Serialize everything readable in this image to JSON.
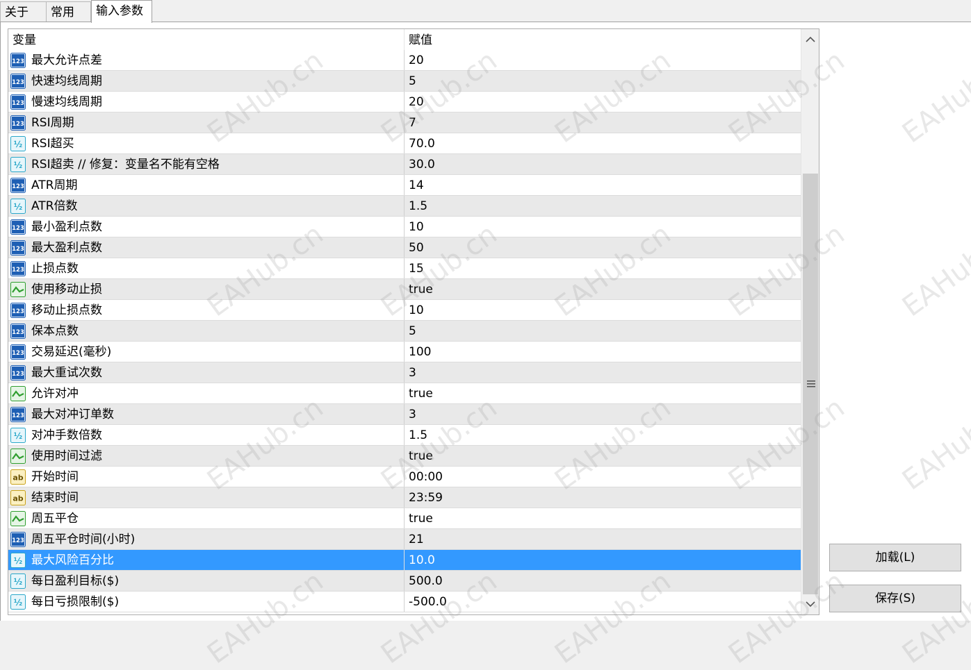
{
  "tabs": [
    {
      "label": "关于",
      "active": false
    },
    {
      "label": "常用",
      "active": false
    },
    {
      "label": "输入参数",
      "active": true
    }
  ],
  "table": {
    "columns": [
      "变量",
      "赋值"
    ],
    "rows": [
      {
        "type": "int",
        "name": "最大允许点差",
        "value": "20"
      },
      {
        "type": "int",
        "name": "快速均线周期",
        "value": "5"
      },
      {
        "type": "int",
        "name": "慢速均线周期",
        "value": "20"
      },
      {
        "type": "int",
        "name": "RSI周期",
        "value": "7"
      },
      {
        "type": "double",
        "name": "RSI超买",
        "value": "70.0"
      },
      {
        "type": "double",
        "name": "RSI超卖  // 修复：变量名不能有空格",
        "value": "30.0"
      },
      {
        "type": "int",
        "name": "ATR周期",
        "value": "14"
      },
      {
        "type": "double",
        "name": "ATR倍数",
        "value": "1.5"
      },
      {
        "type": "int",
        "name": "最小盈利点数",
        "value": "10"
      },
      {
        "type": "int",
        "name": "最大盈利点数",
        "value": "50"
      },
      {
        "type": "int",
        "name": "止损点数",
        "value": "15"
      },
      {
        "type": "bool",
        "name": "使用移动止损",
        "value": "true"
      },
      {
        "type": "int",
        "name": "移动止损点数",
        "value": "10"
      },
      {
        "type": "int",
        "name": "保本点数",
        "value": "5"
      },
      {
        "type": "int",
        "name": "交易延迟(毫秒)",
        "value": "100"
      },
      {
        "type": "int",
        "name": "最大重试次数",
        "value": "3"
      },
      {
        "type": "bool",
        "name": "允许对冲",
        "value": "true"
      },
      {
        "type": "int",
        "name": "最大对冲订单数",
        "value": "3"
      },
      {
        "type": "double",
        "name": "对冲手数倍数",
        "value": "1.5"
      },
      {
        "type": "bool",
        "name": "使用时间过滤",
        "value": "true"
      },
      {
        "type": "string",
        "name": "开始时间",
        "value": "00:00"
      },
      {
        "type": "string",
        "name": "结束时间",
        "value": "23:59"
      },
      {
        "type": "bool",
        "name": "周五平仓",
        "value": "true"
      },
      {
        "type": "int",
        "name": "周五平仓时间(小时)",
        "value": "21"
      },
      {
        "type": "double",
        "name": "最大风险百分比",
        "value": "10.0",
        "selected": true
      },
      {
        "type": "double",
        "name": "每日盈利目标($)",
        "value": "500.0"
      },
      {
        "type": "double",
        "name": "每日亏损限制($)",
        "value": "-500.0"
      }
    ]
  },
  "buttons": {
    "load": "加载(L)",
    "save": "保存(S)"
  },
  "icons": {
    "int": "int-type-icon",
    "double": "double-type-icon",
    "bool": "bool-type-icon",
    "string": "string-type-icon"
  },
  "icon_labels": {
    "int": "123",
    "double": "½",
    "string": "ab"
  },
  "watermark": "EAHub.cn",
  "colors": {
    "selection": "#3399ff",
    "row_alt": "#e9e9e9",
    "icon_int": "#1e5fb4",
    "icon_double": "#2aa7c9",
    "icon_bool": "#2f9e2f",
    "icon_string": "#c9a21a"
  }
}
